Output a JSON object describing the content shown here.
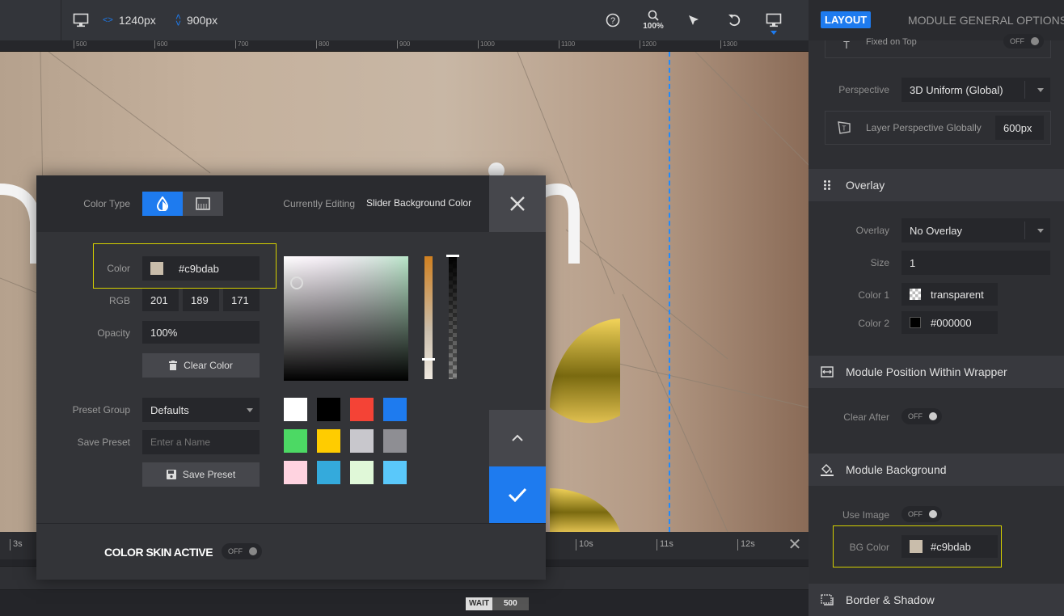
{
  "topbar": {
    "width_value": "1240px",
    "height_value": "900px",
    "zoom_label": "100%"
  },
  "ruler": {
    "ticks": [
      "500",
      "600",
      "700",
      "800",
      "900",
      "1000",
      "1100",
      "1200",
      "1300"
    ]
  },
  "timeline": {
    "ticks": [
      "3s",
      "10s",
      "11s",
      "12s"
    ],
    "wait_label": "WAIT",
    "wait_value": "500"
  },
  "dialog": {
    "color_type_label": "Color Type",
    "currently_editing_label": "Currently Editing",
    "currently_editing_value": "Slider Background Color",
    "color_label": "Color",
    "color_value": "#c9bdab",
    "rgb_label": "RGB",
    "rgb": [
      "201",
      "189",
      "171"
    ],
    "opacity_label": "Opacity",
    "opacity_value": "100%",
    "clear_color_label": "Clear Color",
    "preset_group_label": "Preset Group",
    "preset_group_value": "Defaults",
    "save_preset_label": "Save Preset",
    "save_preset_placeholder": "Enter a Name",
    "save_preset_button": "Save Preset",
    "color_skin_label": "COLOR SKIN ACTIVE",
    "color_skin_toggle": "OFF",
    "presets": [
      "#ffffff",
      "#000000",
      "#f44336",
      "#1e7bef",
      "#4cd964",
      "#ffcc00",
      "#c8c7cc",
      "#8e8e93",
      "#ffd3e0",
      "#34aadc",
      "#e0f8d8",
      "#5ac8fa"
    ]
  },
  "panel": {
    "tab_layout": "LAYOUT",
    "tab_general": "MODULE GENERAL OPTIONS",
    "fixed_on_top_label": "Fixed on Top",
    "fixed_on_top_toggle": "OFF",
    "perspective_label": "Perspective",
    "perspective_value": "3D Uniform (Global)",
    "layer_perspective_label": "Layer Perspective Globally",
    "layer_perspective_value": "600px",
    "overlay_section": "Overlay",
    "overlay_label": "Overlay",
    "overlay_value": "No Overlay",
    "size_label": "Size",
    "size_value": "1",
    "color1_label": "Color 1",
    "color1_value": "transparent",
    "color2_label": "Color 2",
    "color2_value": "#000000",
    "position_section": "Module Position Within Wrapper",
    "clear_after_label": "Clear After",
    "clear_after_toggle": "OFF",
    "background_section": "Module Background",
    "use_image_label": "Use Image",
    "use_image_toggle": "OFF",
    "bg_color_label": "BG Color",
    "bg_color_value": "#c9bdab",
    "border_section": "Border & Shadow"
  },
  "colors": {
    "accent": "#1e7bef",
    "highlight": "#d4d000",
    "bg_color": "#c9bdab"
  }
}
